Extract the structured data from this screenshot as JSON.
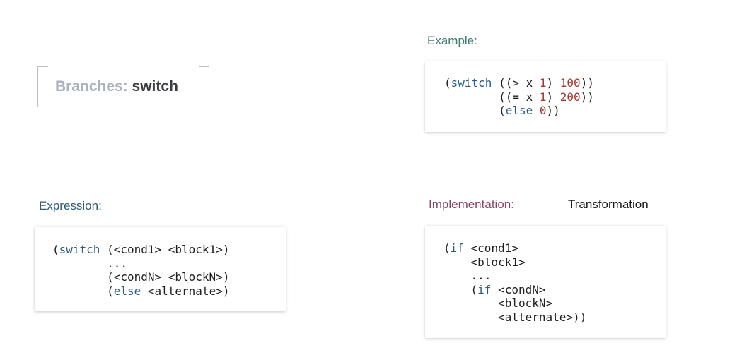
{
  "title": {
    "prefix": "Branches:",
    "keyword": "switch"
  },
  "example": {
    "label": "Example:",
    "code": [
      [
        {
          "t": "("
        },
        {
          "t": "switch",
          "c": "kw"
        },
        {
          "t": " ((> x "
        },
        {
          "t": "1",
          "c": "num"
        },
        {
          "t": ") "
        },
        {
          "t": "100",
          "c": "num"
        },
        {
          "t": "))"
        }
      ],
      [
        {
          "t": "        ((= x "
        },
        {
          "t": "1",
          "c": "num"
        },
        {
          "t": ") "
        },
        {
          "t": "200",
          "c": "num"
        },
        {
          "t": "))"
        }
      ],
      [
        {
          "t": "        ("
        },
        {
          "t": "else",
          "c": "kw"
        },
        {
          "t": " "
        },
        {
          "t": "0",
          "c": "num"
        },
        {
          "t": "))"
        }
      ]
    ]
  },
  "expression": {
    "label": "Expression:",
    "code": [
      [
        {
          "t": "("
        },
        {
          "t": "switch",
          "c": "kw"
        },
        {
          "t": " (<cond1> <block1>)"
        }
      ],
      [
        {
          "t": "        ..."
        }
      ],
      [
        {
          "t": "        (<condN> <blockN>)"
        }
      ],
      [
        {
          "t": "        ("
        },
        {
          "t": "else",
          "c": "kw"
        },
        {
          "t": " <alternate>)"
        }
      ]
    ]
  },
  "implementation": {
    "label": "Implementation:",
    "code": [
      [
        {
          "t": "("
        },
        {
          "t": "if",
          "c": "kw"
        },
        {
          "t": " <cond1>"
        }
      ],
      [
        {
          "t": "    <block1>"
        }
      ],
      [
        {
          "t": "    ..."
        }
      ],
      [
        {
          "t": "    ("
        },
        {
          "t": "if",
          "c": "kw"
        },
        {
          "t": " <condN>"
        }
      ],
      [
        {
          "t": "        <blockN>"
        }
      ],
      [
        {
          "t": "        <alternate>))"
        }
      ]
    ]
  },
  "transformation": {
    "label": "Transformation"
  }
}
